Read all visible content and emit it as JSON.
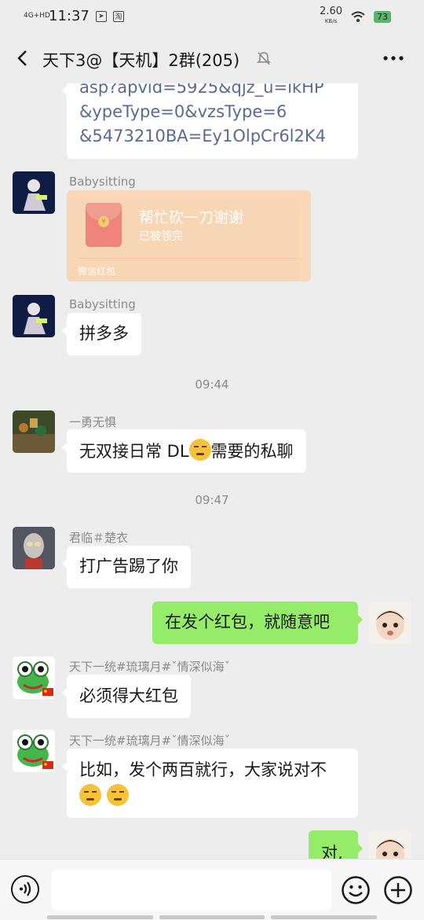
{
  "status_bar": {
    "network": "4G+HD",
    "time": "11:37",
    "speed_value": "2.60",
    "speed_unit": "KB/s",
    "battery": "73"
  },
  "header": {
    "title": "天下3@【天机】2群(205)"
  },
  "messages": {
    "m0": {
      "lines": [
        "asp?apvid=5925&qjz_u=ikHP",
        "&ypeType=0&vzsType=6",
        "&5473210BA=Ey1OlpCr6l2K4"
      ]
    },
    "m1": {
      "sender": "Babysitting",
      "red_packet_title": "帮忙砍一刀谢谢",
      "red_packet_status": "已被领完",
      "red_packet_footer": "微信红包"
    },
    "m2": {
      "sender": "Babysitting",
      "text": "拼多多"
    },
    "t1": "09:44",
    "m3": {
      "sender": "一勇无惧",
      "text_a": "无双接日常 DL",
      "text_b": "需要的私聊"
    },
    "t2": "09:47",
    "m4": {
      "sender": "君临＃楚衣",
      "text": "打广告踢了你"
    },
    "m5": {
      "text": "在发个红包，就随意吧"
    },
    "m6": {
      "sender": "天下一统#琉璃月#ˇ情深似海ˇ",
      "text": "必须得大红包"
    },
    "m7": {
      "sender": "天下一统#琉璃月#ˇ情深似海ˇ",
      "text": "比如，发个两百就行，大家说对不"
    },
    "m8": {
      "text": "对,"
    }
  },
  "input_bar": {
    "value": ""
  },
  "colors": {
    "background": "#ededed",
    "my_bubble": "#95ec69",
    "other_bubble": "#ffffff",
    "red_packet": "#f9d4b0"
  }
}
